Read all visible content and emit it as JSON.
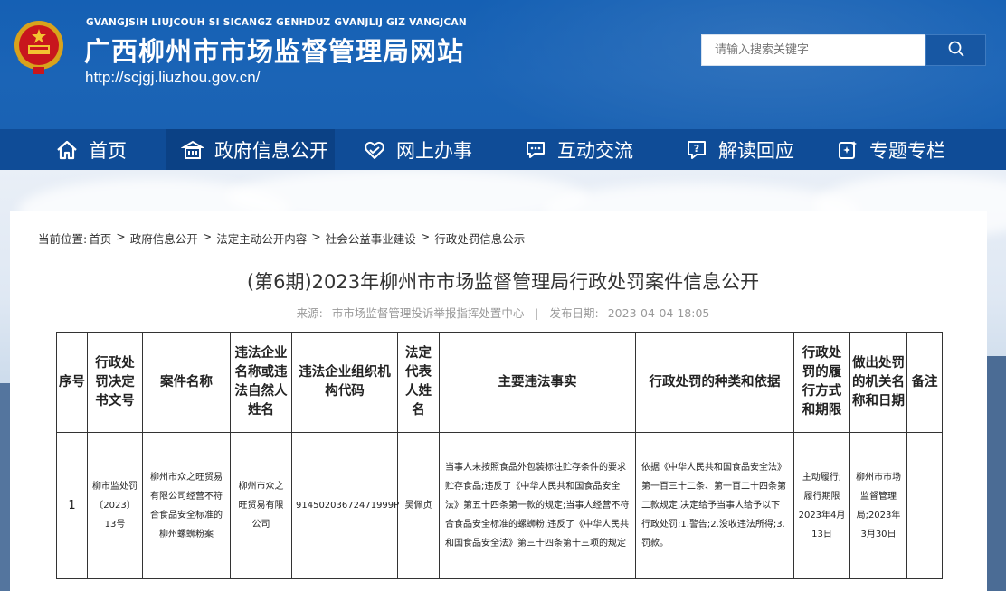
{
  "header": {
    "pinyin": "GVANGJSIH LIUJCOUH SI SICANGZ GENHDUZ GVANJLIJ GIZ VANGJCAN",
    "site_name": "广西柳州市市场监督管理局网站",
    "site_url": "http://scjgj.liuzhou.gov.cn/",
    "emblem_icon": "national-emblem-icon"
  },
  "search": {
    "placeholder": "请输入搜索关键字",
    "button_icon": "search-icon"
  },
  "nav": {
    "items": [
      {
        "label": "首页",
        "icon": "home-icon"
      },
      {
        "label": "政府信息公开",
        "icon": "building-icon",
        "active": true
      },
      {
        "label": "网上办事",
        "icon": "handshake-icon"
      },
      {
        "label": "互动交流",
        "icon": "chat-icon"
      },
      {
        "label": "解读回应",
        "icon": "question-chat-icon"
      },
      {
        "label": "专题专栏",
        "icon": "sparkle-doc-icon"
      }
    ]
  },
  "breadcrumb": {
    "prefix": "当前位置:",
    "items": [
      "首页",
      "政府信息公开",
      "法定主动公开内容",
      "社会公益事业建设",
      "行政处罚信息公示"
    ],
    "separator": ">"
  },
  "article": {
    "title": "(第6期)2023年柳州市市场监督管理局行政处罚案件信息公开",
    "source_label": "来源:",
    "source": "市市场监督管理投诉举报指挥处置中心",
    "date_label": "发布日期:",
    "date": "2023-04-04 18:05"
  },
  "table": {
    "headers": [
      "序号",
      "行政处罚决定书文号",
      "案件名称",
      "违法企业名称或违法自然人姓名",
      "违法企业组织机构代码",
      "法定代表人姓名",
      "主要违法事实",
      "行政处罚的种类和依据",
      "行政处罚的履行方式和期限",
      "做出处罚的机关名称和日期",
      "备注"
    ],
    "rows": [
      {
        "no": "1",
        "doc_no": "柳市监处罚〔2023〕13号",
        "case_name": "柳州市众之旺贸易有限公司经营不符合食品安全标准的柳州螺蛳粉案",
        "party": "柳州市众之旺贸易有限公司",
        "org_code": "91450203672471999P",
        "legal_rep": "吴佩贞",
        "facts": "当事人未按照食品外包装标注贮存条件的要求贮存食品;违反了《中华人民共和国食品安全法》第五十四条第一款的规定;当事人经营不符合食品安全标准的螺蛳粉,违反了《中华人民共和国食品安全法》第三十四条第十三项的规定",
        "penalty": "依据《中华人民共和国食品安全法》第一百三十二条、第一百二十四条第二款规定,决定给予当事人给予以下行政处罚:1.警告;2.没收违法所得;3.罚款。",
        "execution": "主动履行;履行期限2023年4月13日",
        "authority": "柳州市市场监督管理局;2023年3月30日",
        "remark": ""
      }
    ]
  },
  "colors": {
    "header_blue": "#1a62b3",
    "nav_blue": "#0f4c97",
    "nav_active": "#0b4185"
  }
}
